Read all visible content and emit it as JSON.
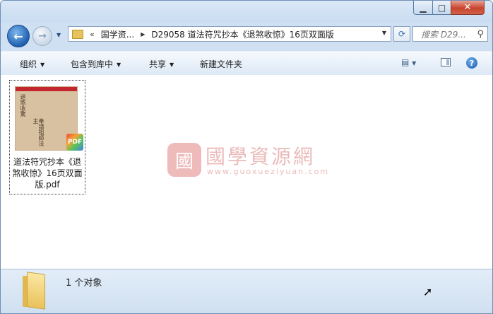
{
  "window": {
    "controls": {
      "minimize": "▁",
      "maximize": "□",
      "close": "✕"
    }
  },
  "nav": {
    "back": "←",
    "forward": "→",
    "history_dropdown": "▼",
    "address": {
      "chevron": "«",
      "crumbs": [
        "国学资...",
        "D29058 道法符咒抄本《退煞收惊》16页双面版"
      ],
      "separator": "▶",
      "dropdown": "▼"
    },
    "refresh": "⟳",
    "search_placeholder": "搜索 D29...",
    "search_icon": "search-icon"
  },
  "toolbar": {
    "organize": "组织",
    "include_library": "包含到库中",
    "share": "共享",
    "new_folder": "新建文件夹",
    "view_icon": "views-icon",
    "preview_icon": "preview-pane-icon",
    "help": "?"
  },
  "content": {
    "files": [
      {
        "name": "道法符咒抄本《退煞收惊》16页双面版.pdf",
        "badge": "PDF",
        "thumb_glyphs": [
          "退煞收驚",
          "奉請祖師法主"
        ]
      }
    ],
    "watermark": {
      "logo": "國",
      "title": "國學資源網",
      "url": "www.guoxueziyuan.com"
    }
  },
  "details": {
    "count": "1 个对象"
  },
  "colors": {
    "accent": "#1f5fb0",
    "close_red": "#c8442e",
    "details_bg": "#dde9f6"
  }
}
